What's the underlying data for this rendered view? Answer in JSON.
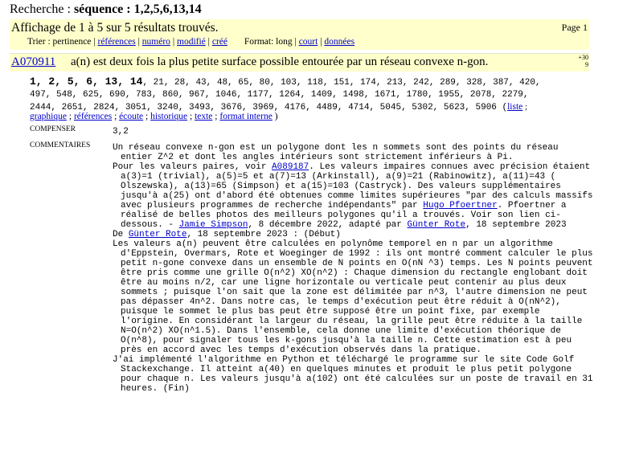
{
  "search": {
    "prefix": "Recherche : ",
    "query": "séquence : 1,2,5,6,13,14"
  },
  "results": {
    "count_text": "Affichage de 1 à 5 sur 5 résultats trouvés.",
    "page_label": "Page 1"
  },
  "sort": {
    "label": "Trier : pertinence",
    "options": [
      "références",
      "numéro",
      "modifié",
      "créé"
    ],
    "format_label": "Format: long",
    "format_options": [
      "court",
      "données"
    ]
  },
  "entry": {
    "anum": "A070911",
    "name": "a(n) est deux fois la plus petite surface possible entourée par un réseau convexe n-gon.",
    "votes_top": "+30",
    "votes_bottom": "9",
    "seq_first": "1, 2, 5, 6, 13, 14",
    "seq_rest_1": ", 21, 28, 43, 48, 65, 80, 103, 118, 151, 174, 213, 242, 289, 328, 387, 420,",
    "seq_rest_2": "497, 548, 625, 690, 783, 860, 967, 1046, 1177, 1264, 1409, 1498, 1671, 1780, 1955, 2078, 2279,",
    "seq_rest_3": "2444, 2651, 2824, 3051, 3240, 3493, 3676, 3969, 4176, 4489, 4714, 5045, 5302, 5623, 5906 (",
    "link_liste": "liste",
    "links": [
      "graphique",
      "références",
      "écoute",
      "historique",
      "texte",
      "format interne"
    ],
    "offset_label": "COMPENSER",
    "offset_value": "3,2",
    "comments_label": "COMMENTAIRES",
    "c1": "Un réseau convexe n-gon est un polygone dont les n sommets sont des points du réseau entier Z^2 et dont les angles intérieurs sont strictement inférieurs à Pi.",
    "c2a": "Pour les valeurs paires, voir",
    "c2link": "A089187",
    "c2b": ". Les valeurs impaires connues avec précision étaient a(3)=1 (trivial), a(5)=5 et a(7)=13 (Arkinstall), a(9)=21 (Rabinowitz), a(11)=43 ( Olszewska), a(13)=65 (Simpson) et a(15)=103 (Castryck). Des valeurs supplémentaires jusqu'à a(25) ont d'abord été obtenues comme limites supérieures \"par des calculs massifs avec plusieurs programmes de recherche indépendants\" par",
    "c2link2": "Hugo Pfoertner",
    "c2c": ". Pfoertner a réalisé de belles photos des meilleurs polygones qu'il a trouvés. Voir son lien ci-dessous. -",
    "c2link3": "Jamie Simpson",
    "c2d": ", 8 décembre 2022, adapté par",
    "c2link4": "Günter Rote",
    "c2e": ", 18 septembre 2023",
    "c3a": "De",
    "c3link": "Günter Rote",
    "c3b": ", 18 septembre 2023 : (Début)",
    "c4": "Les valeurs a(n) peuvent être calculées en polynôme temporel en n par un algorithme d'Eppstein, Overmars, Rote et Woeginger de 1992 : ils ont montré comment calculer le plus petit n-gone convexe dans un ensemble de N points en O(nN ^3) temps. Les N points peuvent être pris comme une grille O(n^2) XO(n^2) : Chaque dimension du rectangle englobant doit être au moins n/2, car une ligne horizontale ou verticale peut contenir au plus deux sommets ; puisque l'on sait que la zone est délimitée par n^3, l'autre dimension ne peut pas dépasser 4n^2. Dans notre cas, le temps d'exécution peut être réduit à O(nN^2), puisque le sommet le plus bas peut être supposé être un point fixe, par exemple l'origine. En considérant la largeur du réseau, la grille peut être réduite à la taille N=O(n^2) XO(n^1.5). Dans l'ensemble, cela donne une limite d'exécution théorique de O(n^8), pour signaler tous les k-gons jusqu'à la taille n. Cette estimation est à peu près en accord avec les temps d'exécution observés dans la pratique.",
    "c5": "J'ai implémenté l'algorithme en Python et téléchargé le programme sur le site Code Golf Stackexchange. Il atteint a(40) en quelques minutes et produit le plus petit polygone pour chaque n. Les valeurs jusqu'à a(102) ont été calculées sur un poste de travail en 31 heures. (Fin)"
  }
}
